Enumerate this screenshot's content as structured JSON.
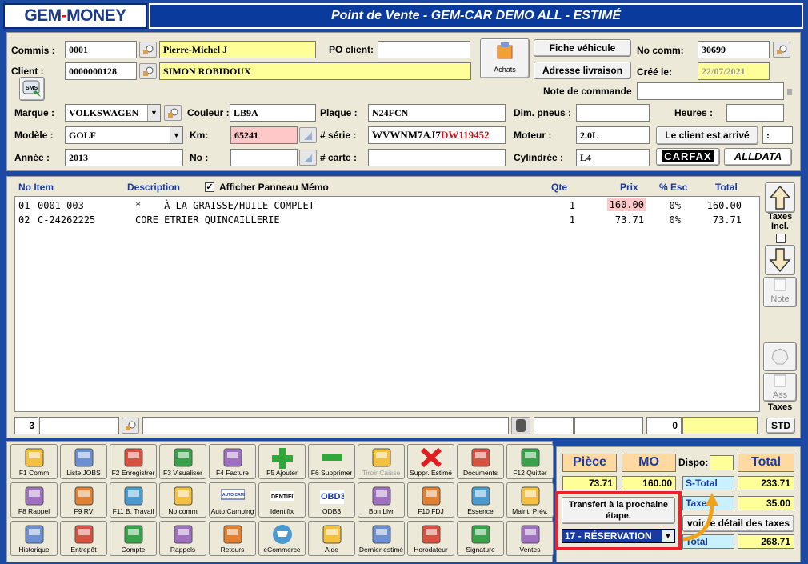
{
  "app": {
    "logo_left": "GEM",
    "logo_dash": "-",
    "logo_right": "MONEY",
    "title": "Point de Vente - GEM-CAR DEMO ALL  - ESTIMÉ"
  },
  "form": {
    "commis_label": "Commis :",
    "commis_code": "0001",
    "commis_name": "Pierre-Michel J",
    "client_label": "Client :",
    "client_code": "0000000128",
    "client_name": "SIMON ROBIDOUX",
    "po_label": "PO client:",
    "po_value": "",
    "achats_label": "Achats",
    "fiche_btn": "Fiche véhicule",
    "adresse_btn": "Adresse livraison",
    "nocomm_label": "No comm:",
    "nocomm_value": "30699",
    "cree_label": "Créé le:",
    "cree_value": "22/07/2021",
    "note_label": "Note de commande",
    "note_value": "",
    "sms_label": "SMS",
    "marque_label": "Marque :",
    "marque_value": "VOLKSWAGEN",
    "couleur_label": "Couleur :",
    "couleur_value": "LB9A",
    "plaque_label": "Plaque :",
    "plaque_value": "N24FCN",
    "dim_label": "Dim. pneus :",
    "dim_value": "",
    "heures_label": "Heures :",
    "heures_value": "",
    "modele_label": "Modèle :",
    "modele_value": "GOLF",
    "km_label": "Km:",
    "km_value": "65241",
    "serie_label": "# série :",
    "serie_black": "WVWNM7AJ7",
    "serie_red": "DW119452",
    "moteur_label": "Moteur :",
    "moteur_value": "2.0L",
    "arrive_btn": "Le client est arrivé",
    "arrive_value": ":",
    "annee_label": "Année :",
    "annee_value": "2013",
    "no_label": "No :",
    "no_value": "",
    "carte_label": "# carte :",
    "carte_value": "",
    "cyl_label": "Cylindrée :",
    "cyl_value": "L4",
    "carfax": "CARFAX",
    "alldata": "ALLDATA"
  },
  "grid": {
    "headers": {
      "item": "No Item",
      "desc": "Description",
      "memo": "Afficher Panneau Mémo",
      "qte": "Qte",
      "prix": "Prix",
      "esc": "% Esc",
      "total": "Total"
    },
    "rows": [
      {
        "no": "01",
        "item": "0001-003",
        "desc": "*    À LA GRAISSE/HUILE COMPLET",
        "qte": "1",
        "prix": "160.00",
        "esc": "0%",
        "total": "160.00"
      },
      {
        "no": "02",
        "item": "C-24262225",
        "desc": "CORE ETRIER QUINCAILLERIE",
        "qte": "1",
        "prix": "73.71",
        "esc": "0%",
        "total": "73.71"
      }
    ],
    "footer_count": "3",
    "footer_zero": "0"
  },
  "side": {
    "taxes_incl": "Taxes Incl.",
    "note": "Note",
    "ass": "Ass",
    "taxes": "Taxes",
    "std": "STD"
  },
  "toolbar": [
    [
      "F1 Comm",
      "Liste JOBS",
      "F2 Enregistrer",
      "F3 Visualiser",
      "F4 Facture",
      "F5 Ajouter",
      "F6 Supprimer",
      "Tiroir Caisse",
      "Suppr. Estimé",
      "Documents",
      "F12 Quitter"
    ],
    [
      "F8 Rappel",
      "F9 RV",
      "F11 B. Travail",
      "No comm",
      "Auto Camping",
      "Identifix",
      "ODB3",
      "Bon Livr",
      "F10 FDJ",
      "Essence",
      "Maint. Prév."
    ],
    [
      "Historique",
      "Entrepôt",
      "Compte",
      "Rappels",
      "Retours",
      "eCommerce",
      "Aide",
      "Dernier estimé",
      "Horodateur",
      "Signature",
      "Ventes"
    ]
  ],
  "toolbar_logos": {
    "auto_camping": "AUTO CAMPING",
    "identifix": "DENTIFIX",
    "odb3": "OBD3"
  },
  "summary": {
    "piece_label": "Pièce",
    "mo_label": "MO",
    "dispo_label": "Dispo:",
    "total_label": "Total",
    "piece_value": "73.71",
    "mo_value": "160.00",
    "stotal_label": "S-Total",
    "stotal_value": "233.71",
    "taxes_label": "Taxes",
    "taxes_value": "35.00",
    "detail_btn": "voir le détail des taxes",
    "total_row_label": "Total",
    "total_value": "268.71",
    "transfert_btn": "Transfert à la prochaine étape.",
    "etape_value": "17 - RÉSERVATION"
  },
  "colors": {
    "highlight": "#e8242a",
    "arrow": "#f0a21a"
  }
}
